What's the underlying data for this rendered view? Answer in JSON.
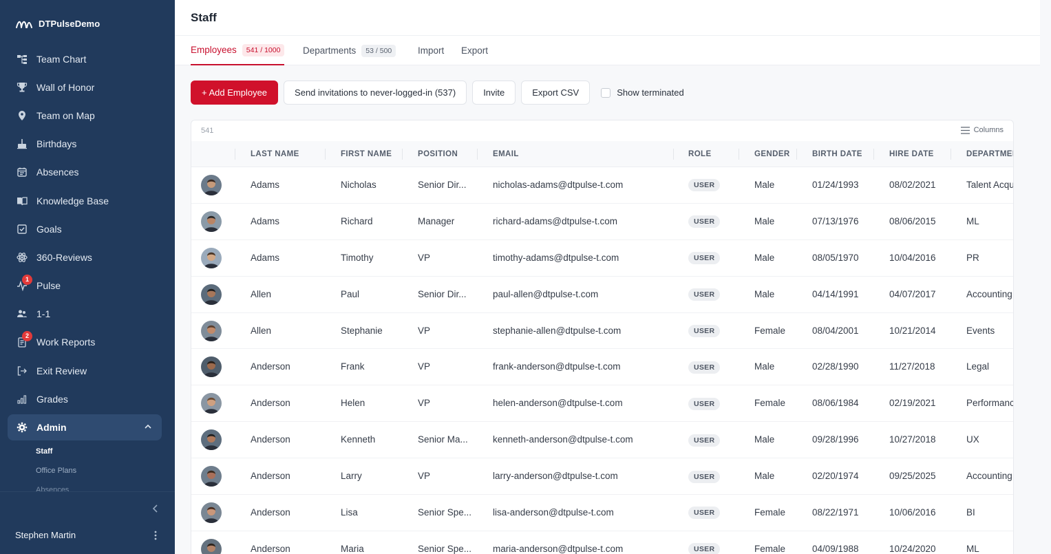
{
  "brand": {
    "name": "DTPulseDemo"
  },
  "sidebar": {
    "items": [
      {
        "label": "Team Chart",
        "icon": "org-chart-icon"
      },
      {
        "label": "Wall of Honor",
        "icon": "trophy-icon"
      },
      {
        "label": "Team on Map",
        "icon": "map-pin-icon"
      },
      {
        "label": "Birthdays",
        "icon": "cake-icon"
      },
      {
        "label": "Absences",
        "icon": "calendar-icon"
      },
      {
        "label": "Knowledge Base",
        "icon": "book-icon"
      },
      {
        "label": "Goals",
        "icon": "checkbox-icon"
      },
      {
        "label": "360-Reviews",
        "icon": "atom-icon"
      },
      {
        "label": "Pulse",
        "icon": "pulse-icon",
        "badge": "1"
      },
      {
        "label": "1-1",
        "icon": "users-icon"
      },
      {
        "label": "Work Reports",
        "icon": "report-icon",
        "badge": "2"
      },
      {
        "label": "Exit Review",
        "icon": "exit-icon"
      },
      {
        "label": "Grades",
        "icon": "bar-chart-icon"
      },
      {
        "label": "Admin",
        "icon": "gear-icon",
        "active": true
      }
    ],
    "admin_sub": [
      "Staff",
      "Office Plans",
      "Absences"
    ],
    "user_name": "Stephen Martin"
  },
  "header": {
    "title": "Staff"
  },
  "tabs": [
    {
      "label": "Employees",
      "count": "541 / 1000",
      "active": true
    },
    {
      "label": "Departments",
      "count": "53 / 500"
    },
    {
      "label": "Import"
    },
    {
      "label": "Export"
    }
  ],
  "toolbar": {
    "add_label": "+ Add Employee",
    "invite_all_label": "Send invitations to never-logged-in (537)",
    "invite_label": "Invite",
    "export_label": "Export CSV",
    "show_terminated_label": "Show terminated"
  },
  "table": {
    "count": "541",
    "columns_label": "Columns",
    "headers": [
      "LAST NAME",
      "FIRST NAME",
      "POSITION",
      "EMAIL",
      "ROLE",
      "GENDER",
      "BIRTH DATE",
      "HIRE DATE",
      "DEPARTMENT"
    ],
    "rows": [
      {
        "last": "Adams",
        "first": "Nicholas",
        "position": "Senior Dir...",
        "email": "nicholas-adams@dtpulse-t.com",
        "role": "USER",
        "gender": "Male",
        "birth": "01/24/1993",
        "hire": "08/02/2021",
        "dept": "Talent Acquisition"
      },
      {
        "last": "Adams",
        "first": "Richard",
        "position": "Manager",
        "email": "richard-adams@dtpulse-t.com",
        "role": "USER",
        "gender": "Male",
        "birth": "07/13/1976",
        "hire": "08/06/2015",
        "dept": "ML"
      },
      {
        "last": "Adams",
        "first": "Timothy",
        "position": "VP",
        "email": "timothy-adams@dtpulse-t.com",
        "role": "USER",
        "gender": "Male",
        "birth": "08/05/1970",
        "hire": "10/04/2016",
        "dept": "PR"
      },
      {
        "last": "Allen",
        "first": "Paul",
        "position": "Senior Dir...",
        "email": "paul-allen@dtpulse-t.com",
        "role": "USER",
        "gender": "Male",
        "birth": "04/14/1991",
        "hire": "04/07/2017",
        "dept": "Accounting"
      },
      {
        "last": "Allen",
        "first": "Stephanie",
        "position": "VP",
        "email": "stephanie-allen@dtpulse-t.com",
        "role": "USER",
        "gender": "Female",
        "birth": "08/04/2001",
        "hire": "10/21/2014",
        "dept": "Events"
      },
      {
        "last": "Anderson",
        "first": "Frank",
        "position": "VP",
        "email": "frank-anderson@dtpulse-t.com",
        "role": "USER",
        "gender": "Male",
        "birth": "02/28/1990",
        "hire": "11/27/2018",
        "dept": "Legal"
      },
      {
        "last": "Anderson",
        "first": "Helen",
        "position": "VP",
        "email": "helen-anderson@dtpulse-t.com",
        "role": "USER",
        "gender": "Female",
        "birth": "08/06/1984",
        "hire": "02/19/2021",
        "dept": "Performance"
      },
      {
        "last": "Anderson",
        "first": "Kenneth",
        "position": "Senior Ma...",
        "email": "kenneth-anderson@dtpulse-t.com",
        "role": "USER",
        "gender": "Male",
        "birth": "09/28/1996",
        "hire": "10/27/2018",
        "dept": "UX"
      },
      {
        "last": "Anderson",
        "first": "Larry",
        "position": "VP",
        "email": "larry-anderson@dtpulse-t.com",
        "role": "USER",
        "gender": "Male",
        "birth": "02/20/1974",
        "hire": "09/25/2025",
        "dept": "Accounting"
      },
      {
        "last": "Anderson",
        "first": "Lisa",
        "position": "Senior Spe...",
        "email": "lisa-anderson@dtpulse-t.com",
        "role": "USER",
        "gender": "Female",
        "birth": "08/22/1971",
        "hire": "10/06/2016",
        "dept": "BI"
      },
      {
        "last": "Anderson",
        "first": "Maria",
        "position": "Senior Spe...",
        "email": "maria-anderson@dtpulse-t.com",
        "role": "USER",
        "gender": "Female",
        "birth": "04/09/1988",
        "hire": "10/24/2020",
        "dept": "ML"
      }
    ]
  },
  "colors": {
    "sidebar": "#213a5c",
    "accent": "#d0112b",
    "badge": "#e23a3a"
  }
}
